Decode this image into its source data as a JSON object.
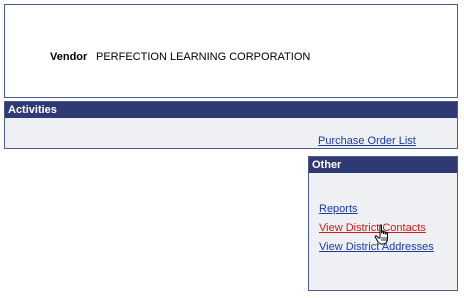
{
  "vendor": {
    "label": "Vendor",
    "value": "PERFECTION LEARNING CORPORATION"
  },
  "activities": {
    "title": "Activities",
    "links": [
      {
        "label": "Purchase Order List"
      }
    ]
  },
  "other": {
    "title": "Other",
    "links": [
      {
        "label": "Reports"
      },
      {
        "label": "View District Contacts"
      },
      {
        "label": "View District Addresses"
      }
    ]
  },
  "colors": {
    "header_bg": "#2f3a74",
    "link": "#1a3ba3",
    "link_hover": "#d01a1a",
    "panel_bg": "#eef0f3"
  },
  "cursor_icon": "hand-pointer-icon"
}
